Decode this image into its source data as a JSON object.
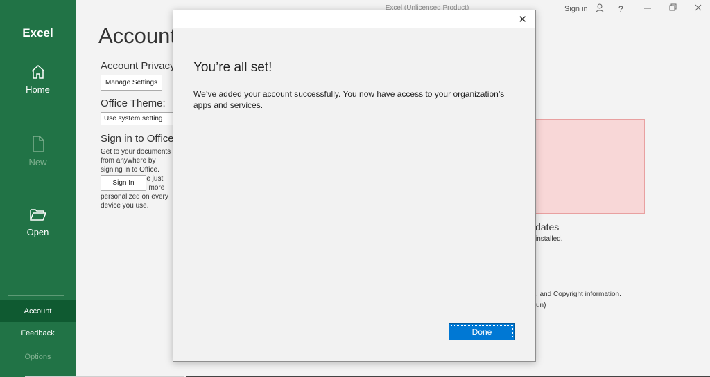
{
  "window": {
    "title": "Excel (Unlicensed Product)",
    "sign_in": "Sign in",
    "controls": [
      "feedback-person-icon",
      "help-icon",
      "minimize-icon",
      "restore-icon",
      "close-icon"
    ],
    "help_glyph": "?"
  },
  "sidebar": {
    "app_name": "Excel",
    "items": [
      {
        "label": "Home",
        "icon": "home-icon"
      },
      {
        "label": "New",
        "icon": "new-document-icon"
      },
      {
        "label": "Open",
        "icon": "open-folder-icon"
      }
    ],
    "bottom_items": [
      {
        "label": "Account",
        "selected": true
      },
      {
        "label": "Feedback"
      },
      {
        "label": "Options"
      }
    ],
    "colors": {
      "background": "#217346",
      "selected": "#0f5a31"
    }
  },
  "account_page": {
    "title": "Account",
    "privacy_heading": "Account Privacy",
    "manage_settings": "Manage Settings",
    "theme_heading": "Office Theme:",
    "theme_value": "Use system setting",
    "signin_heading": "Sign in to Office",
    "signin_description": "Get to your documents from anywhere by signing in to Office. Your experience just gets better and more personalized on every device you use.",
    "signin_button": "Sign In",
    "updates_heading": "dates",
    "updates_description": "installed.",
    "about_description": ", and Copyright information.",
    "about_version": "un)"
  },
  "dialog": {
    "heading": "You’re all set!",
    "message": "We’ve added your account successfully. You now have access to your organization’s apps and services.",
    "done_label": "Done",
    "close_glyph": "✕",
    "colors": {
      "primary": "#0078d4"
    }
  }
}
